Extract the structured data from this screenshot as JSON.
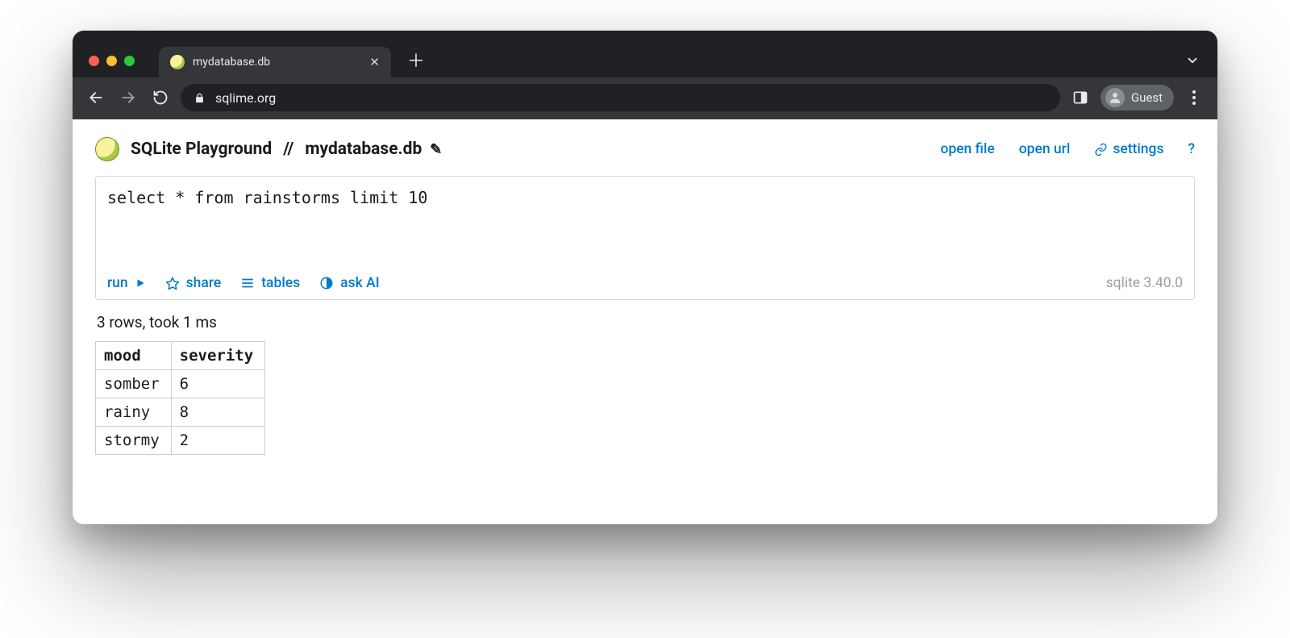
{
  "browser": {
    "tab_title": "mydatabase.db",
    "url": "sqlime.org",
    "profile_label": "Guest"
  },
  "header": {
    "app_title": "SQLite Playground",
    "separator": "//",
    "db_name": "mydatabase.db",
    "links": {
      "open_file": "open file",
      "open_url": "open url",
      "settings": "settings",
      "help": "?"
    }
  },
  "editor": {
    "sql": "select * from rainstorms limit 10",
    "actions": {
      "run": "run",
      "share": "share",
      "tables": "tables",
      "ask_ai": "ask AI"
    },
    "version": "sqlite 3.40.0"
  },
  "status": "3 rows, took 1 ms",
  "results": {
    "columns": [
      "mood",
      "severity"
    ],
    "rows": [
      [
        "somber",
        "6"
      ],
      [
        "rainy",
        "8"
      ],
      [
        "stormy",
        "2"
      ]
    ]
  }
}
